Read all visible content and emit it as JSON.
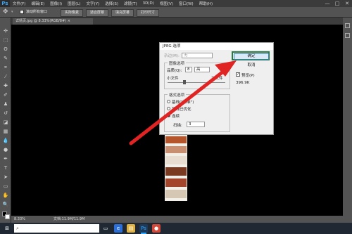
{
  "app": {
    "logo": "Ps"
  },
  "menubar": {
    "items": [
      "文件(F)",
      "编辑(E)",
      "图像(I)",
      "图层(L)",
      "文字(Y)",
      "选择(S)",
      "滤镜(T)",
      "3D(D)",
      "视图(V)",
      "窗口(W)",
      "帮助(H)"
    ],
    "window_controls": [
      "—",
      "□",
      "✕"
    ]
  },
  "optionsbar": {
    "checkbox_label": "滚动所有窗口",
    "buttons": [
      "实际像素",
      "适合屏幕",
      "填充屏幕",
      "打印尺寸"
    ]
  },
  "document_tab": {
    "label": "详情页.jpg @ 8.33%(RGB/8#) ×"
  },
  "statusbar": {
    "zoom": "8.33%",
    "doc_info": "文档:11.9M/11.9M"
  },
  "dialog": {
    "title": "JPEG 选项",
    "matte_label": "杂边(M):",
    "matte_value": "无",
    "image_options_legend": "图像选项",
    "quality_label": "品质(Q):",
    "quality_value": "8",
    "quality_level": "高",
    "small_file_label": "小文件",
    "large_file_label": "大文件",
    "format_options_legend": "格式选项",
    "format_options": [
      "基线(\"标准\")",
      "基线已优化",
      "连续"
    ],
    "scans_label": "扫描:",
    "scans_value": "3",
    "ok_label": "确定",
    "cancel_label": "取消",
    "preview_label": "预览(P)",
    "file_size": "396.9K"
  },
  "colors": {
    "arrow": "#e02424",
    "highlight": "#1f7a45",
    "canvas": "#000000",
    "panel": "#535353"
  },
  "icons": {
    "taskbar": [
      "start-icon",
      "search-icon",
      "taskview-icon",
      "edge-icon",
      "explorer-icon",
      "photoshop-icon",
      "chrome-icon"
    ]
  }
}
